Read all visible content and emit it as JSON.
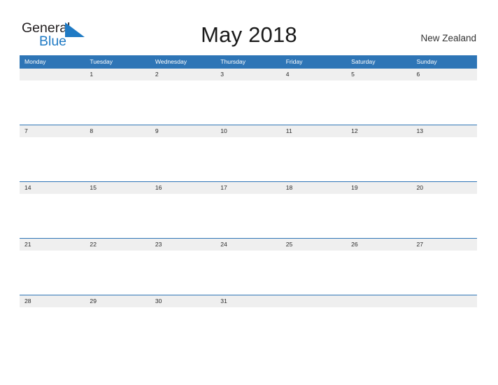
{
  "brand": {
    "name_top": "General",
    "name_bottom": "Blue",
    "triangle_icon": "blue-triangle-icon",
    "colors": {
      "text_dark": "#231f20",
      "blue": "#1f7ac4"
    }
  },
  "header": {
    "title": "May 2018",
    "locale": "New Zealand"
  },
  "calendar": {
    "month": "May",
    "year": "2018",
    "accent_color": "#2e75b6",
    "band_color": "#efefef",
    "day_names": [
      "Monday",
      "Tuesday",
      "Wednesday",
      "Thursday",
      "Friday",
      "Saturday",
      "Sunday"
    ],
    "weeks": [
      [
        "",
        "1",
        "2",
        "3",
        "4",
        "5",
        "6"
      ],
      [
        "7",
        "8",
        "9",
        "10",
        "11",
        "12",
        "13"
      ],
      [
        "14",
        "15",
        "16",
        "17",
        "18",
        "19",
        "20"
      ],
      [
        "21",
        "22",
        "23",
        "24",
        "25",
        "26",
        "27"
      ],
      [
        "28",
        "29",
        "30",
        "31",
        "",
        "",
        ""
      ]
    ]
  }
}
